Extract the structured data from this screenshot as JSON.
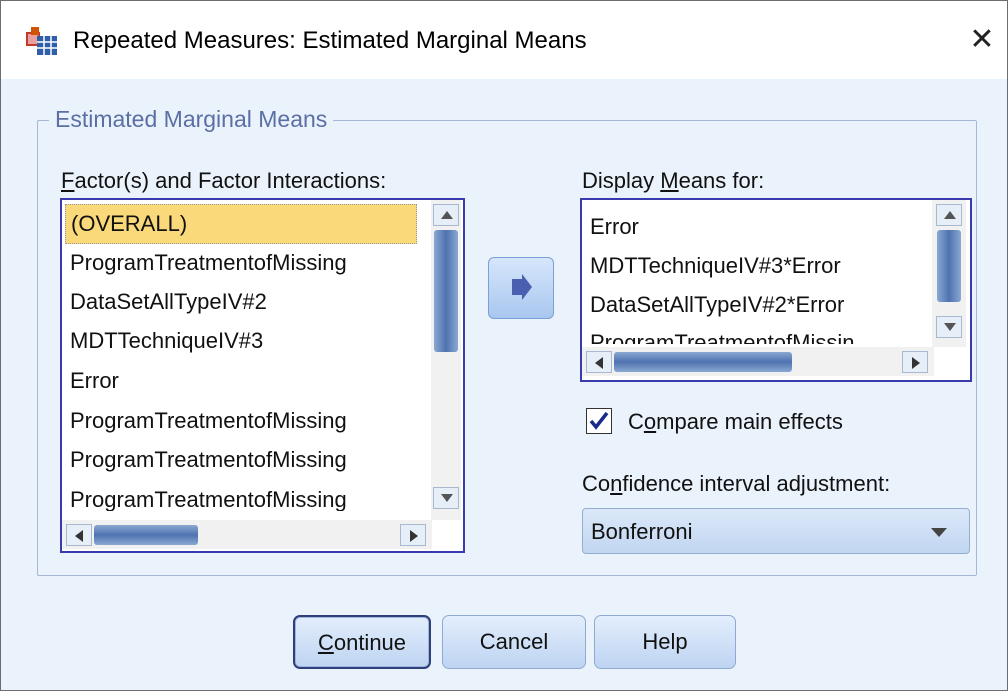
{
  "window": {
    "title": "Repeated Measures: Estimated Marginal Means",
    "close_glyph": "✕"
  },
  "group": {
    "legend": "Estimated Marginal Means"
  },
  "factors": {
    "label_pre": "",
    "label_u": "F",
    "label_post": "actor(s) and Factor Interactions:",
    "items": [
      "(OVERALL)",
      "ProgramTreatmentofMissing",
      "DataSetAllTypeIV#2",
      "MDTTechniqueIV#3",
      "Error",
      "ProgramTreatmentofMissing",
      "ProgramTreatmentofMissing",
      "ProgramTreatmentofMissing"
    ],
    "selected_index": 0
  },
  "move_button": {
    "icon": "right-arrow-icon"
  },
  "display_means": {
    "label_pre": "Display ",
    "label_u": "M",
    "label_post": "eans for:",
    "items": [
      "Error",
      "MDTTechniqueIV#3*Error",
      "DataSetAllTypeIV#2*Error",
      "ProgramTreatmentofMissin"
    ]
  },
  "compare": {
    "checked": true,
    "label_pre": "C",
    "label_u": "o",
    "label_post": "mpare main effects"
  },
  "ci": {
    "label_pre": "Co",
    "label_u": "n",
    "label_post": "fidence interval adjustment:",
    "selected": "Bonferroni"
  },
  "buttons": {
    "continue_u": "C",
    "continue_rest": "ontinue",
    "cancel": "Cancel",
    "help": "Help"
  },
  "colors": {
    "dialog_bg": "#eaf2fb",
    "selection": "#f9d97a",
    "list_border": "#3a3ab0",
    "legend_text": "#5b6fa5"
  }
}
